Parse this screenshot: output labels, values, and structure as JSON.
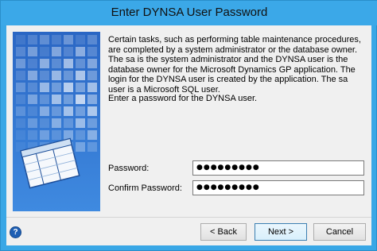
{
  "window": {
    "title": "Enter DYNSA User Password"
  },
  "content": {
    "description": "Certain tasks, such as performing table maintenance procedures, are completed by a system administrator or the database owner.  The sa is the system administrator and the DYNSA user is the database owner for the Microsoft Dynamics GP application. The login for the DYNSA user is created by the application.  The sa user is a Microsoft SQL user.",
    "prompt": "Enter a password for the DYNSA user."
  },
  "form": {
    "password_label": "Password:",
    "password_value": "●●●●●●●●●",
    "confirm_label": "Confirm Password:",
    "confirm_value": "●●●●●●●●●"
  },
  "buttons": {
    "help_icon": "?",
    "back_label": "< Back",
    "next_label": "Next >",
    "cancel_label": "Cancel"
  },
  "colors": {
    "title_bar": "#3ba8e8",
    "side_art": "#2c6bc8"
  }
}
